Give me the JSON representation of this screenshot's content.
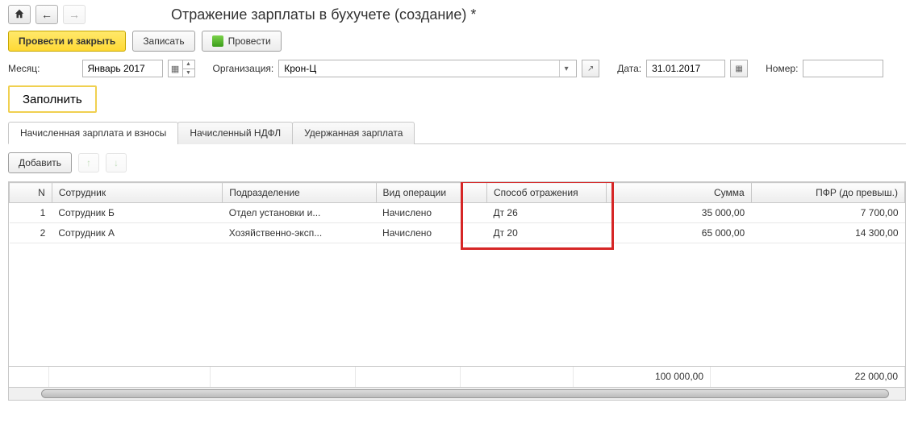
{
  "title": "Отражение зарплаты в бухучете (создание) *",
  "nav": {
    "home": "⌂",
    "back": "←",
    "fwd": "→"
  },
  "toolbar": {
    "process_close": "Провести и закрыть",
    "save": "Записать",
    "process": "Провести"
  },
  "form": {
    "month_label": "Месяц:",
    "month_value": "Январь 2017",
    "org_label": "Организация:",
    "org_value": "Крон-Ц",
    "date_label": "Дата:",
    "date_value": "31.01.2017",
    "number_label": "Номер:",
    "number_value": ""
  },
  "fill_btn": "Заполнить",
  "tabs": [
    "Начисленная зарплата и взносы",
    "Начисленный НДФЛ",
    "Удержанная зарплата"
  ],
  "subtoolbar": {
    "add": "Добавить",
    "up": "↑",
    "down": "↓"
  },
  "grid": {
    "headers": {
      "n": "N",
      "employee": "Сотрудник",
      "dept": "Подразделение",
      "op": "Вид операции",
      "ref": "Способ отражения",
      "sum": "Сумма",
      "pfr": "ПФР (до превыш.)"
    },
    "rows": [
      {
        "n": "1",
        "employee": "Сотрудник Б",
        "dept": "Отдел установки и...",
        "op": "Начислено",
        "ref": "Дт 26",
        "sum": "35 000,00",
        "pfr": "7 700,00"
      },
      {
        "n": "2",
        "employee": "Сотрудник А",
        "dept": "Хозяйственно-эксп...",
        "op": "Начислено",
        "ref": "Дт 20",
        "sum": "65 000,00",
        "pfr": "14 300,00"
      }
    ],
    "totals": {
      "sum": "100 000,00",
      "pfr": "22 000,00"
    }
  }
}
